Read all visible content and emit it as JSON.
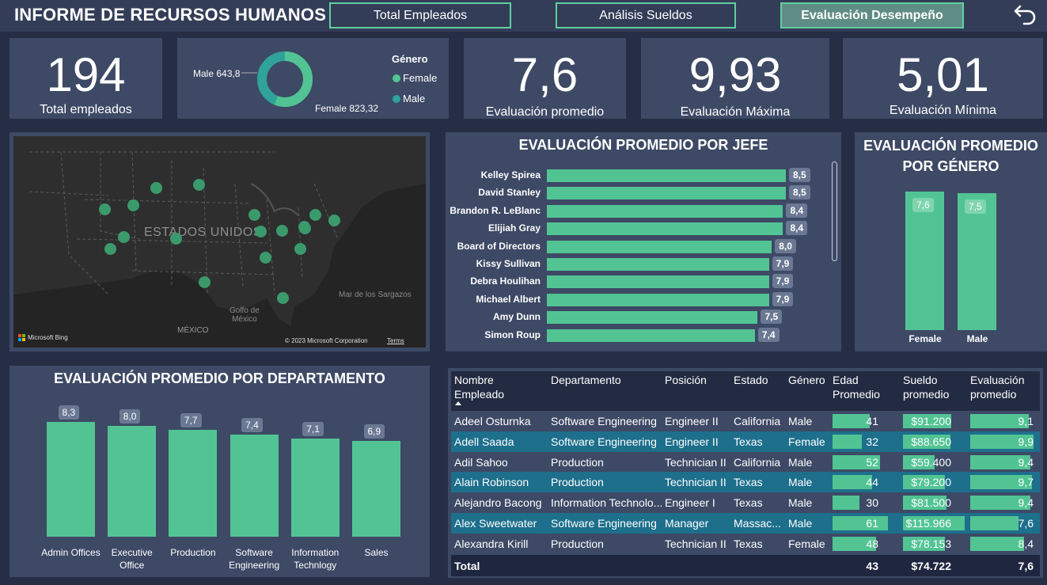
{
  "header": {
    "title": "INFORME DE RECURSOS HUMANOS",
    "tabs": [
      "Total Empleados",
      "Análisis Sueldos",
      "Evaluación Desempeño"
    ],
    "active_tab": "Evaluación Desempeño"
  },
  "kpis": {
    "total_empleados": {
      "value": "194",
      "label": "Total empleados"
    },
    "eval_promedio": {
      "value": "7,6",
      "label": "Evaluación promedio"
    },
    "eval_maxima": {
      "value": "9,93",
      "label": "Evaluación Máxima"
    },
    "eval_minima": {
      "value": "5,01",
      "label": "Evaluación Mínima"
    }
  },
  "gender_donut": {
    "legend_title": "Género",
    "legend": [
      "Female",
      "Male"
    ],
    "male_label": "Male 643,8",
    "female_label": "Female 823,32",
    "colors": {
      "female": "#52c494",
      "male": "#2fa39a"
    },
    "values": {
      "male": 643.8,
      "female": 823.32
    }
  },
  "map": {
    "country_label": "ESTADOS UNIDOS",
    "mexico_label": "MÉXICO",
    "gulf_label": "Golfo de\nMéxico",
    "sea_label": "Mar de los Sargazos",
    "bing_label": "Microsoft Bing",
    "copyright": "© 2023 Microsoft Corporation",
    "terms": "Terms"
  },
  "chart_data": [
    {
      "type": "bar",
      "title": "EVALUACIÓN PROMEDIO POR JEFE",
      "categories": [
        "Kelley Spirea",
        "David Stanley",
        "Brandon R. LeBlanc",
        "Elijiah Gray",
        "Board of Directors",
        "Kissy Sullivan",
        "Debra Houlihan",
        "Michael Albert",
        "Amy Dunn",
        "Simon Roup"
      ],
      "values": [
        8.5,
        8.5,
        8.4,
        8.4,
        8.0,
        7.9,
        7.9,
        7.9,
        7.5,
        7.4
      ],
      "labels": [
        "8,5",
        "8,5",
        "8,4",
        "8,4",
        "8,0",
        "7,9",
        "7,9",
        "7,9",
        "7,5",
        "7,4"
      ]
    },
    {
      "type": "bar",
      "title": "EVALUACIÓN PROMEDIO POR GÉNERO",
      "categories": [
        "Female",
        "Male"
      ],
      "values": [
        7.6,
        7.5
      ],
      "labels": [
        "7,6",
        "7,5"
      ]
    },
    {
      "type": "bar",
      "title": "EVALUACIÓN PROMEDIO POR DEPARTAMENTO",
      "categories": [
        "Admin Offices",
        "Executive Office",
        "Production",
        "Software Engineering",
        "Information Technlogy",
        "Sales"
      ],
      "values": [
        8.3,
        8.0,
        7.7,
        7.4,
        7.1,
        6.9
      ],
      "labels": [
        "8,3",
        "8,0",
        "7,7",
        "7,4",
        "7,1",
        "6,9"
      ]
    }
  ],
  "table": {
    "headers": [
      "Nombre Empleado",
      "Departamento",
      "Posición",
      "Estado",
      "Género",
      "Edad Promedio",
      "Sueldo promedio",
      "Evaluación promedio"
    ],
    "rows": [
      {
        "nombre": "Adeel Osturnka",
        "dep": "Software Engineering",
        "pos": "Engineer II",
        "estado": "California",
        "genero": "Male",
        "edad": 41,
        "edad_t": "41",
        "sueldo": 91200,
        "sueldo_t": "$91.200",
        "eval": 9.1,
        "eval_t": "9,1"
      },
      {
        "nombre": "Adell Saada",
        "dep": "Software Engineering",
        "pos": "Engineer II",
        "estado": "Texas",
        "genero": "Female",
        "edad": 32,
        "edad_t": "32",
        "sueldo": 88650,
        "sueldo_t": "$88.650",
        "eval": 9.9,
        "eval_t": "9,9"
      },
      {
        "nombre": "Adil Sahoo",
        "dep": "Production",
        "pos": "Technician II",
        "estado": "California",
        "genero": "Male",
        "edad": 52,
        "edad_t": "52",
        "sueldo": 59400,
        "sueldo_t": "$59.400",
        "eval": 9.4,
        "eval_t": "9,4"
      },
      {
        "nombre": "Alain Robinson",
        "dep": "Production",
        "pos": "Technician II",
        "estado": "Texas",
        "genero": "Male",
        "edad": 44,
        "edad_t": "44",
        "sueldo": 79200,
        "sueldo_t": "$79.200",
        "eval": 9.7,
        "eval_t": "9,7"
      },
      {
        "nombre": "Alejandro Bacong",
        "dep": "Information Technolo...",
        "pos": "Engineer I",
        "estado": "Texas",
        "genero": "Male",
        "edad": 30,
        "edad_t": "30",
        "sueldo": 81500,
        "sueldo_t": "$81.500",
        "eval": 9.4,
        "eval_t": "9,4"
      },
      {
        "nombre": "Alex Sweetwater",
        "dep": "Software Engineering",
        "pos": "Manager",
        "estado": "Massac...",
        "genero": "Male",
        "edad": 61,
        "edad_t": "61",
        "sueldo": 115966,
        "sueldo_t": "$115.966",
        "eval": 7.6,
        "eval_t": "7,6"
      },
      {
        "nombre": "Alexandra Kirill",
        "dep": "Production",
        "pos": "Technician II",
        "estado": "Texas",
        "genero": "Female",
        "edad": 48,
        "edad_t": "48",
        "sueldo": 78153,
        "sueldo_t": "$78.153",
        "eval": 8.4,
        "eval_t": "8,4"
      }
    ],
    "total": {
      "label": "Total",
      "edad": "43",
      "sueldo": "$74.722",
      "eval": "7,6"
    }
  }
}
